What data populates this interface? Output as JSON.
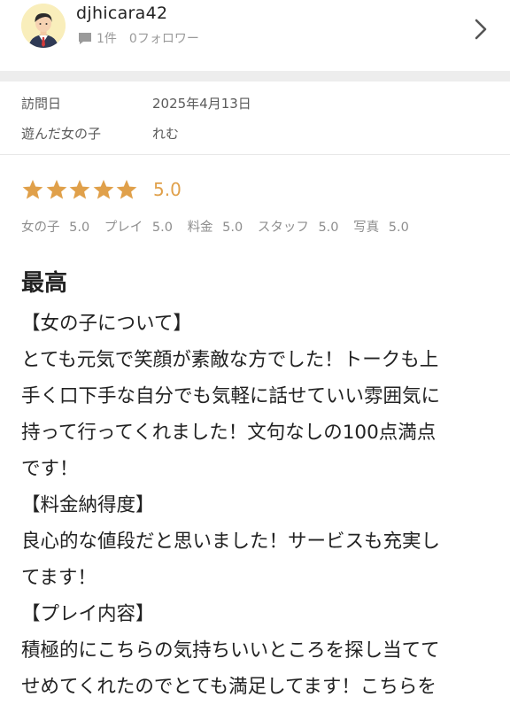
{
  "user": {
    "name": "djhicara42",
    "post_count": "1件",
    "follower_count": "0フォロワー",
    "avatar_icon": "businessman-avatar-icon",
    "comment_icon": "comment-icon",
    "nav_icon": "chevron-right-icon"
  },
  "info": {
    "visit_label": "訪問日",
    "visit_value": "2025年4月13日",
    "girl_label": "遊んだ女の子",
    "girl_value": "れむ"
  },
  "rating": {
    "overall": "5.0",
    "stars": 5,
    "star_color": "#e0a04a",
    "sub_scores": [
      {
        "label": "女の子",
        "value": "5.0"
      },
      {
        "label": "プレイ",
        "value": "5.0"
      },
      {
        "label": "料金",
        "value": "5.0"
      },
      {
        "label": "スタッフ",
        "value": "5.0"
      },
      {
        "label": "写真",
        "value": "5.0"
      }
    ]
  },
  "review": {
    "title": "最高",
    "lines": [
      "【女の子について】",
      "とても元気で笑顔が素敵な方でした！トークも上",
      "手く口下手な自分でも気軽に話せていい雰囲気に",
      "持って行ってくれました！文句なしの100点満点",
      "です！",
      "【料金納得度】",
      "良心的な値段だと思いました！サービスも充実し",
      "てます！",
      "【プレイ内容】",
      "積極的にこちらの気持ちいいところを探し当てて",
      "せめてくれたのでとても満足してます！こちらを"
    ]
  }
}
